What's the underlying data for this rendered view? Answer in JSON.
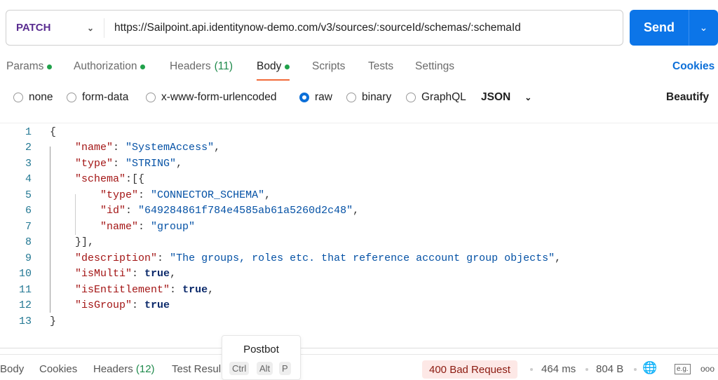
{
  "request": {
    "method": "PATCH",
    "url": "https://Sailpoint.api.identitynow-demo.com/v3/sources/:sourceId/schemas/:schemaId",
    "send_label": "Send"
  },
  "tabs": [
    {
      "label": "Params",
      "dot": true
    },
    {
      "label": "Authorization",
      "dot": true
    },
    {
      "label": "Headers",
      "count": "(11)"
    },
    {
      "label": "Body",
      "dot": true,
      "active": true
    },
    {
      "label": "Scripts"
    },
    {
      "label": "Tests"
    },
    {
      "label": "Settings"
    }
  ],
  "cookies_label": "Cookies",
  "body_options": [
    "none",
    "form-data",
    "x-www-form-urlencoded",
    "raw",
    "binary",
    "GraphQL"
  ],
  "selected_body_option": "raw",
  "format": "JSON",
  "beautify_label": "Beautify",
  "code_lines": [
    [
      [
        "p",
        "{"
      ]
    ],
    [
      [
        "p",
        "    "
      ],
      [
        "k",
        "\"name\""
      ],
      [
        "p",
        ": "
      ],
      [
        "s",
        "\"SystemAccess\""
      ],
      [
        "p",
        ","
      ]
    ],
    [
      [
        "p",
        "    "
      ],
      [
        "k",
        "\"type\""
      ],
      [
        "p",
        ": "
      ],
      [
        "s",
        "\"STRING\""
      ],
      [
        "p",
        ","
      ]
    ],
    [
      [
        "p",
        "    "
      ],
      [
        "k",
        "\"schema\""
      ],
      [
        "p",
        ":[{"
      ]
    ],
    [
      [
        "p",
        "        "
      ],
      [
        "k",
        "\"type\""
      ],
      [
        "p",
        ": "
      ],
      [
        "s",
        "\"CONNECTOR_SCHEMA\""
      ],
      [
        "p",
        ","
      ]
    ],
    [
      [
        "p",
        "        "
      ],
      [
        "k",
        "\"id\""
      ],
      [
        "p",
        ": "
      ],
      [
        "s",
        "\"649284861f784e4585ab61a5260d2c48\""
      ],
      [
        "p",
        ","
      ]
    ],
    [
      [
        "p",
        "        "
      ],
      [
        "k",
        "\"name\""
      ],
      [
        "p",
        ": "
      ],
      [
        "s",
        "\"group\""
      ]
    ],
    [
      [
        "p",
        "    }],"
      ]
    ],
    [
      [
        "p",
        "    "
      ],
      [
        "k",
        "\"description\""
      ],
      [
        "p",
        ": "
      ],
      [
        "s",
        "\"The groups, roles etc. that reference account group objects\""
      ],
      [
        "p",
        ","
      ]
    ],
    [
      [
        "p",
        "    "
      ],
      [
        "k",
        "\"isMulti\""
      ],
      [
        "p",
        ": "
      ],
      [
        "b",
        "true"
      ],
      [
        "p",
        ","
      ]
    ],
    [
      [
        "p",
        "    "
      ],
      [
        "k",
        "\"isEntitlement\""
      ],
      [
        "p",
        ": "
      ],
      [
        "b",
        "true"
      ],
      [
        "p",
        ","
      ]
    ],
    [
      [
        "p",
        "    "
      ],
      [
        "k",
        "\"isGroup\""
      ],
      [
        "p",
        ": "
      ],
      [
        "b",
        "true"
      ]
    ],
    [
      [
        "p",
        "}"
      ]
    ]
  ],
  "response": {
    "tabs": [
      "Body",
      "Cookies",
      "Headers",
      "Test Resul"
    ],
    "headers_count": "(12)",
    "status": "400 Bad Request",
    "time": "464 ms",
    "size": "804 B",
    "examples_label": "e.g.",
    "more": "ooo"
  },
  "postbot": {
    "title": "Postbot",
    "keys": [
      "Ctrl",
      "Alt",
      "P"
    ]
  }
}
